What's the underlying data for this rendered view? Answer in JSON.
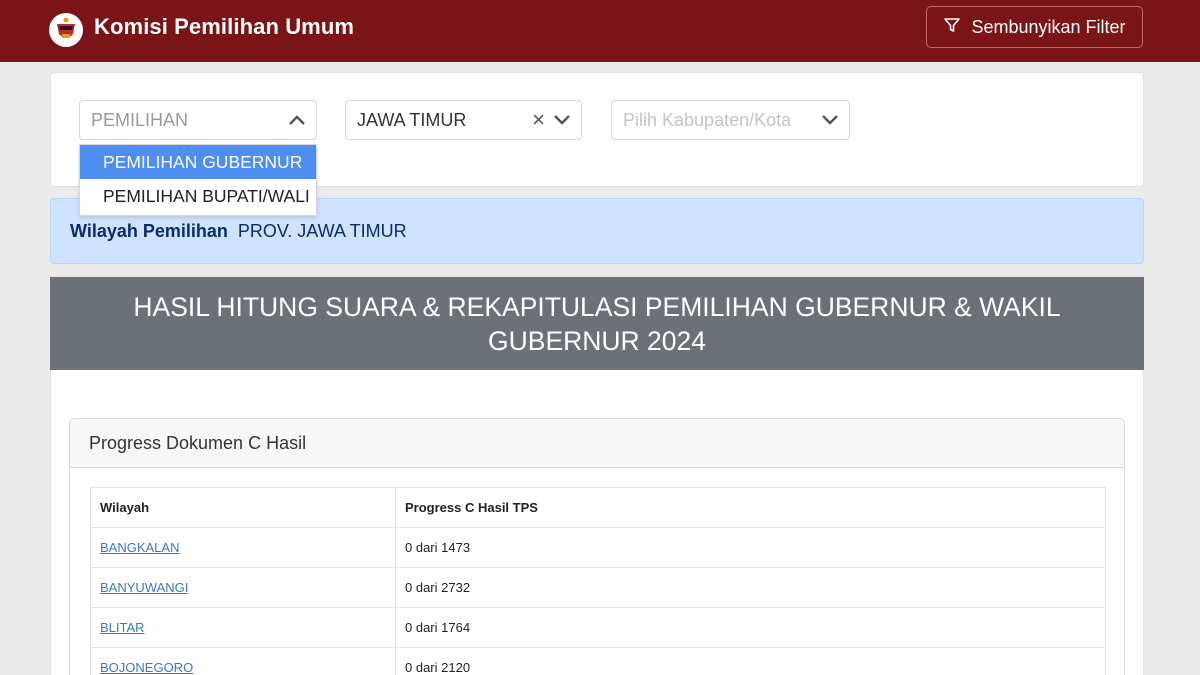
{
  "header": {
    "brand": "Komisi Pemilihan Umum",
    "filter_button": "Sembunyikan Filter"
  },
  "filters": {
    "pemilihan": {
      "placeholder": "PEMILIHAN"
    },
    "provinsi": {
      "value": "JAWA TIMUR"
    },
    "kabupaten": {
      "placeholder": "Pilih Kabupaten/Kota"
    },
    "dropdown_options": [
      {
        "label": "PEMILIHAN GUBERNUR",
        "selected": true
      },
      {
        "label": "PEMILIHAN BUPATI/WALI",
        "selected": false
      }
    ]
  },
  "info": {
    "label": "Wilayah Pemilihan",
    "value": "PROV. JAWA TIMUR"
  },
  "title": "HASIL HITUNG SUARA & REKAPITULASI PEMILIHAN GUBERNUR & WAKIL GUBERNUR 2024",
  "progress_card": {
    "header": "Progress Dokumen C Hasil",
    "columns": [
      "Wilayah",
      "Progress C Hasil TPS"
    ],
    "rows": [
      {
        "wilayah": "BANGKALAN",
        "progress": "0 dari 1473"
      },
      {
        "wilayah": "BANYUWANGI",
        "progress": "0 dari 2732"
      },
      {
        "wilayah": "BLITAR",
        "progress": "0 dari 1764"
      },
      {
        "wilayah": "BOJONEGORO",
        "progress": "0 dari 2120"
      }
    ]
  },
  "colors": {
    "header_bg": "#7b1416",
    "title_bg": "#6b7176",
    "info_bg": "#cfe2ff",
    "dropdown_active": "#4e8ef0",
    "link": "#3a78c8"
  }
}
